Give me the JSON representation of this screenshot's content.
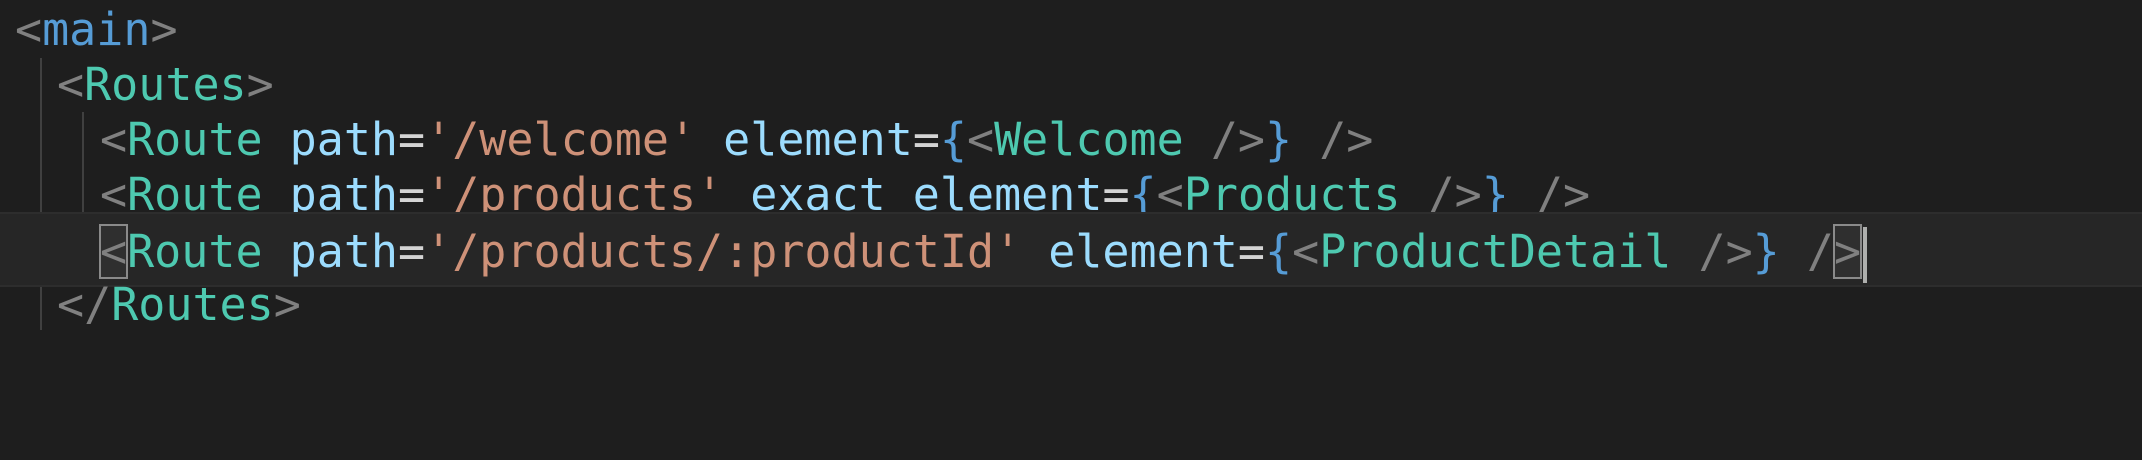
{
  "editor": {
    "lines": [
      {
        "tokens": [
          {
            "text": "<",
            "cls": "t-punc"
          },
          {
            "text": "main",
            "cls": "t-main"
          },
          {
            "text": ">",
            "cls": "t-punc"
          }
        ]
      },
      {
        "tokens": [
          {
            "text": "<",
            "cls": "t-punc"
          },
          {
            "text": "Routes",
            "cls": "t-tag"
          },
          {
            "text": ">",
            "cls": "t-punc"
          }
        ]
      },
      {
        "tokens": [
          {
            "text": "<",
            "cls": "t-punc"
          },
          {
            "text": "Route",
            "cls": "t-tag"
          },
          {
            "text": " ",
            "cls": ""
          },
          {
            "text": "path",
            "cls": "t-attr"
          },
          {
            "text": "=",
            "cls": "t-eq"
          },
          {
            "text": "'/welcome'",
            "cls": "t-str"
          },
          {
            "text": " ",
            "cls": ""
          },
          {
            "text": "element",
            "cls": "t-attr"
          },
          {
            "text": "=",
            "cls": "t-eq"
          },
          {
            "text": "{",
            "cls": "t-brace"
          },
          {
            "text": "<",
            "cls": "t-punc"
          },
          {
            "text": "Welcome",
            "cls": "t-tag"
          },
          {
            "text": " />",
            "cls": "t-punc"
          },
          {
            "text": "}",
            "cls": "t-brace"
          },
          {
            "text": " />",
            "cls": "t-punc"
          }
        ]
      },
      {
        "tokens": [
          {
            "text": "<",
            "cls": "t-punc"
          },
          {
            "text": "Route",
            "cls": "t-tag"
          },
          {
            "text": " ",
            "cls": ""
          },
          {
            "text": "path",
            "cls": "t-attr"
          },
          {
            "text": "=",
            "cls": "t-eq"
          },
          {
            "text": "'/products'",
            "cls": "t-str"
          },
          {
            "text": " ",
            "cls": ""
          },
          {
            "text": "exact",
            "cls": "t-attr"
          },
          {
            "text": " ",
            "cls": ""
          },
          {
            "text": "element",
            "cls": "t-attr"
          },
          {
            "text": "=",
            "cls": "t-eq"
          },
          {
            "text": "{",
            "cls": "t-brace"
          },
          {
            "text": "<",
            "cls": "t-punc"
          },
          {
            "text": "Products",
            "cls": "t-tag"
          },
          {
            "text": " />",
            "cls": "t-punc"
          },
          {
            "text": "}",
            "cls": "t-brace"
          },
          {
            "text": " />",
            "cls": "t-punc"
          }
        ]
      },
      {
        "tokens": [
          {
            "text": "<",
            "cls": "t-punc bracket-match"
          },
          {
            "text": "Route",
            "cls": "t-tag"
          },
          {
            "text": " ",
            "cls": ""
          },
          {
            "text": "path",
            "cls": "t-attr"
          },
          {
            "text": "=",
            "cls": "t-eq"
          },
          {
            "text": "'/products/:productId'",
            "cls": "t-str"
          },
          {
            "text": " ",
            "cls": ""
          },
          {
            "text": "element",
            "cls": "t-attr"
          },
          {
            "text": "=",
            "cls": "t-eq"
          },
          {
            "text": "{",
            "cls": "t-brace"
          },
          {
            "text": "<",
            "cls": "t-punc"
          },
          {
            "text": "ProductDetail",
            "cls": "t-tag"
          },
          {
            "text": " />",
            "cls": "t-punc"
          },
          {
            "text": "}",
            "cls": "t-brace"
          },
          {
            "text": " /",
            "cls": "t-punc"
          },
          {
            "text": ">",
            "cls": "t-punc bracket-match"
          }
        ]
      },
      {
        "tokens": [
          {
            "text": "</",
            "cls": "t-punc"
          },
          {
            "text": "Routes",
            "cls": "t-tag"
          },
          {
            "text": ">",
            "cls": "t-punc"
          }
        ]
      }
    ]
  }
}
